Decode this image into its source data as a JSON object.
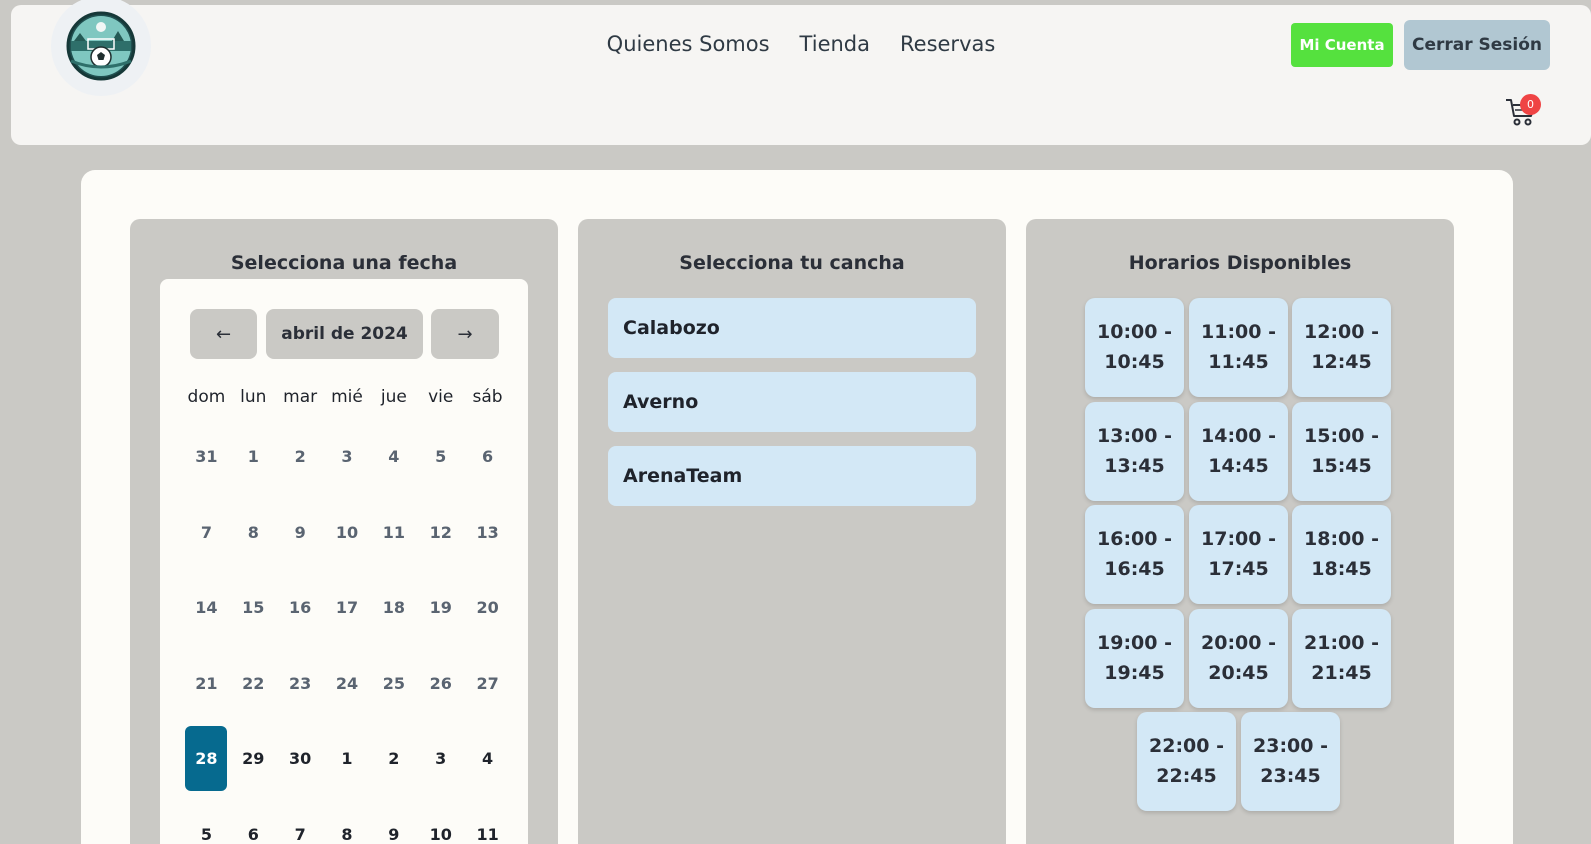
{
  "header": {
    "logo_icon": "soccer-logo-icon",
    "nav": [
      "Quienes Somos",
      "Tienda",
      "Reservas"
    ],
    "mi_cuenta_label": "Mi Cuenta",
    "cerrar_sesion_label": "Cerrar Sesión",
    "cart_icon": "cart-icon",
    "cart_count": "0",
    "colors": {
      "mi_cuenta": "#55e13e",
      "cerrar_sesion": "#b1c7d2",
      "badge": "#ef4444"
    }
  },
  "date_panel": {
    "title": "Selecciona una fecha",
    "prev_label": "←",
    "month_label": "abril de 2024",
    "next_label": "→",
    "weekdays": [
      "dom",
      "lun",
      "mar",
      "mié",
      "jue",
      "vie",
      "sáb"
    ],
    "days": [
      "31",
      "1",
      "2",
      "3",
      "4",
      "5",
      "6",
      "7",
      "8",
      "9",
      "10",
      "11",
      "12",
      "13",
      "14",
      "15",
      "16",
      "17",
      "18",
      "19",
      "20",
      "21",
      "22",
      "23",
      "24",
      "25",
      "26",
      "27",
      "28",
      "29",
      "30",
      "1",
      "2",
      "3",
      "4",
      "5",
      "6",
      "7",
      "8",
      "9",
      "10",
      "11"
    ],
    "selected_day": "28",
    "selected_color": "#066a8f"
  },
  "court_panel": {
    "title": "Selecciona tu cancha",
    "courts": [
      "Calabozo",
      "Averno",
      "ArenaTeam"
    ]
  },
  "time_panel": {
    "title": "Horarios Disponibles",
    "slots": [
      {
        "start": "10:00 -",
        "end": "10:45"
      },
      {
        "start": "11:00 -",
        "end": "11:45"
      },
      {
        "start": "12:00 -",
        "end": "12:45"
      },
      {
        "start": "13:00 -",
        "end": "13:45"
      },
      {
        "start": "14:00 -",
        "end": "14:45"
      },
      {
        "start": "15:00 -",
        "end": "15:45"
      },
      {
        "start": "16:00 -",
        "end": "16:45"
      },
      {
        "start": "17:00 -",
        "end": "17:45"
      },
      {
        "start": "18:00 -",
        "end": "18:45"
      },
      {
        "start": "19:00 -",
        "end": "19:45"
      },
      {
        "start": "20:00 -",
        "end": "20:45"
      },
      {
        "start": "21:00 -",
        "end": "21:45"
      },
      {
        "start": "22:00 -",
        "end": "22:45"
      },
      {
        "start": "23:00 -",
        "end": "23:45"
      }
    ]
  }
}
